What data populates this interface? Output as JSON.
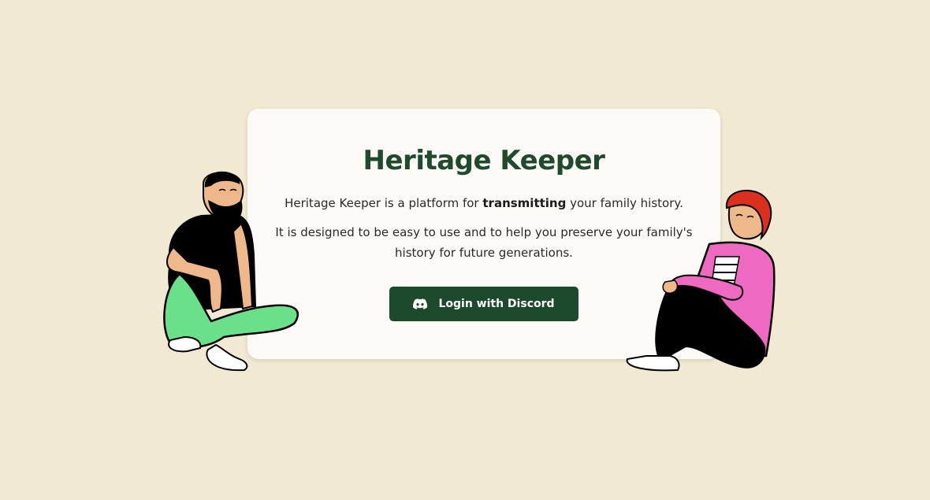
{
  "page": {
    "title": "Heritage Keeper",
    "intro_prefix": "Heritage Keeper is a platform for ",
    "intro_bold": "transmitting",
    "intro_suffix": " your family history.",
    "description": "It is designed to be easy to use and to help you preserve your family's history for future generations."
  },
  "login": {
    "label": "Login with Discord",
    "icon": "discord-icon"
  },
  "illustrations": {
    "left": "man-sitting-illustration",
    "right": "woman-sitting-illustration"
  },
  "colors": {
    "background": "#f2e9d2",
    "card": "#fbfaf6",
    "brand_green": "#1d4a2c"
  }
}
